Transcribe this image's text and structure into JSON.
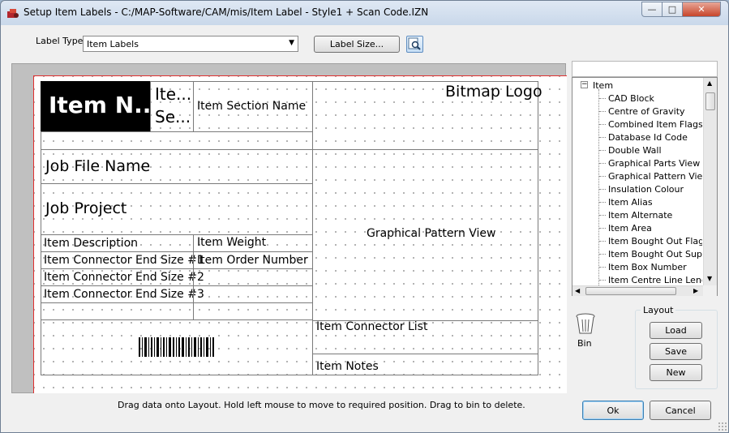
{
  "window": {
    "title": "Setup Item Labels - C:/MAP-Software/CAM/mis/Item Label - Style1 + Scan Code.IZN",
    "minimize": "—",
    "maximize": "□",
    "close": "✕"
  },
  "toolbar": {
    "label_type_caption": "Label Type",
    "label_type_value": "Item Labels",
    "label_size_button": "Label Size...",
    "preview_icon": "zoom-preview-icon"
  },
  "layout_cells": {
    "item_name": "Item N...",
    "item_se_1": "Ite...",
    "item_se_2": "Se...",
    "item_section_name": "Item Section Name",
    "bitmap_logo": "Bitmap Logo",
    "job_file_name": "Job File Name",
    "job_project": "Job Project",
    "item_description": "Item Description",
    "item_weight": "Item Weight",
    "item_connector_end_size_1": "Item Connector End Size #1",
    "item_order_number": "Item Order Number",
    "item_connector_end_size_2": "Item Connector End Size #2",
    "item_connector_end_size_3": "Item Connector End Size #3",
    "graphical_pattern_view": "Graphical Pattern View",
    "item_connector_list": "Item Connector List",
    "item_notes": "Item Notes",
    "barcode_icon": "barcode-icon"
  },
  "tree": {
    "root": "Item",
    "items": [
      "CAD Block",
      "Centre of Gravity",
      "Combined Item Flags Fiel",
      "Database Id Code",
      "Double Wall",
      "Graphical Parts View",
      "Graphical Pattern View",
      "Insulation Colour",
      "Item Alias",
      "Item Alternate",
      "Item Area",
      "Item Bought Out Flag",
      "Item Bought Out Supplier",
      "Item Box Number",
      "Item Centre Line Length"
    ]
  },
  "bin": {
    "label": "Bin",
    "icon": "trash-bin-icon"
  },
  "layout_group": {
    "title": "Layout",
    "load": "Load",
    "save": "Save",
    "new": "New"
  },
  "status": {
    "hint": "Drag data onto Layout. Hold left mouse to move to required position. Drag to bin to delete."
  },
  "dialog_buttons": {
    "ok": "Ok",
    "cancel": "Cancel"
  },
  "colors": {
    "sheet_border": "#e03030",
    "canvas_bg": "#c0c0c0",
    "item_name_bg": "#000000"
  }
}
